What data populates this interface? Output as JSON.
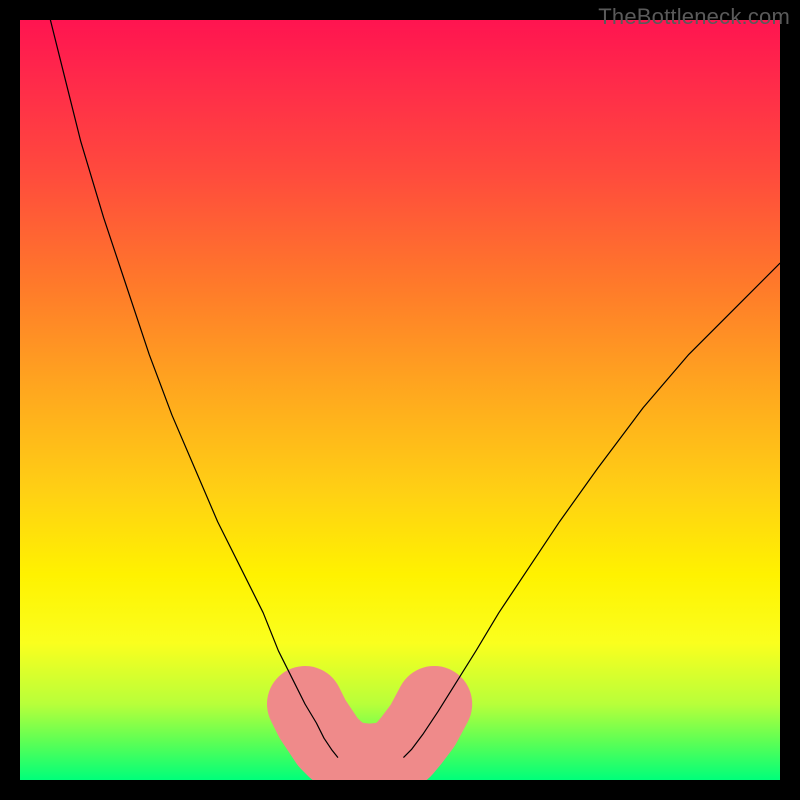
{
  "watermark": "TheBottleneck.com",
  "chart_data": {
    "type": "line",
    "title": "",
    "xlabel": "",
    "ylabel": "",
    "xlim": [
      0,
      100
    ],
    "ylim": [
      0,
      100
    ],
    "grid": false,
    "legend": false,
    "series": [
      {
        "name": "left-curve",
        "color": "#000000",
        "width": 1.2,
        "x": [
          4,
          6,
          8,
          11,
          14,
          17,
          20,
          23,
          26,
          29,
          32,
          34,
          36,
          37.5,
          39,
          40,
          41,
          41.8
        ],
        "y": [
          100,
          92,
          84,
          74,
          65,
          56,
          48,
          41,
          34,
          28,
          22,
          17,
          13,
          10,
          7.5,
          5.5,
          4,
          3
        ]
      },
      {
        "name": "right-curve",
        "color": "#000000",
        "width": 1.2,
        "x": [
          50.5,
          51.5,
          53,
          55,
          57.5,
          60,
          63,
          67,
          71,
          76,
          82,
          88,
          94,
          100
        ],
        "y": [
          3,
          4,
          6,
          9,
          13,
          17,
          22,
          28,
          34,
          41,
          49,
          56,
          62,
          68
        ]
      },
      {
        "name": "bottom-trough",
        "color": "#ef8a8a",
        "width": 10,
        "cap": "round",
        "x": [
          37.5,
          38.5,
          39.5,
          40.5,
          41.5,
          42.5,
          44,
          46,
          48,
          49.5,
          50.5,
          51.5,
          53,
          54.5
        ],
        "y": [
          10,
          8,
          6.5,
          5,
          4,
          3.2,
          2.6,
          2.4,
          2.6,
          3.2,
          4,
          5.2,
          7.2,
          10
        ]
      }
    ],
    "background_gradient": {
      "direction": "vertical",
      "stops": [
        {
          "pos": 0.0,
          "color": "#ff1450"
        },
        {
          "pos": 0.08,
          "color": "#ff2a4a"
        },
        {
          "pos": 0.2,
          "color": "#ff4a3d"
        },
        {
          "pos": 0.35,
          "color": "#ff7a2a"
        },
        {
          "pos": 0.48,
          "color": "#ffa51f"
        },
        {
          "pos": 0.62,
          "color": "#ffd014"
        },
        {
          "pos": 0.73,
          "color": "#fff200"
        },
        {
          "pos": 0.82,
          "color": "#faff1e"
        },
        {
          "pos": 0.9,
          "color": "#b8ff3a"
        },
        {
          "pos": 0.95,
          "color": "#5cff55"
        },
        {
          "pos": 1.0,
          "color": "#00ff7a"
        }
      ]
    }
  }
}
